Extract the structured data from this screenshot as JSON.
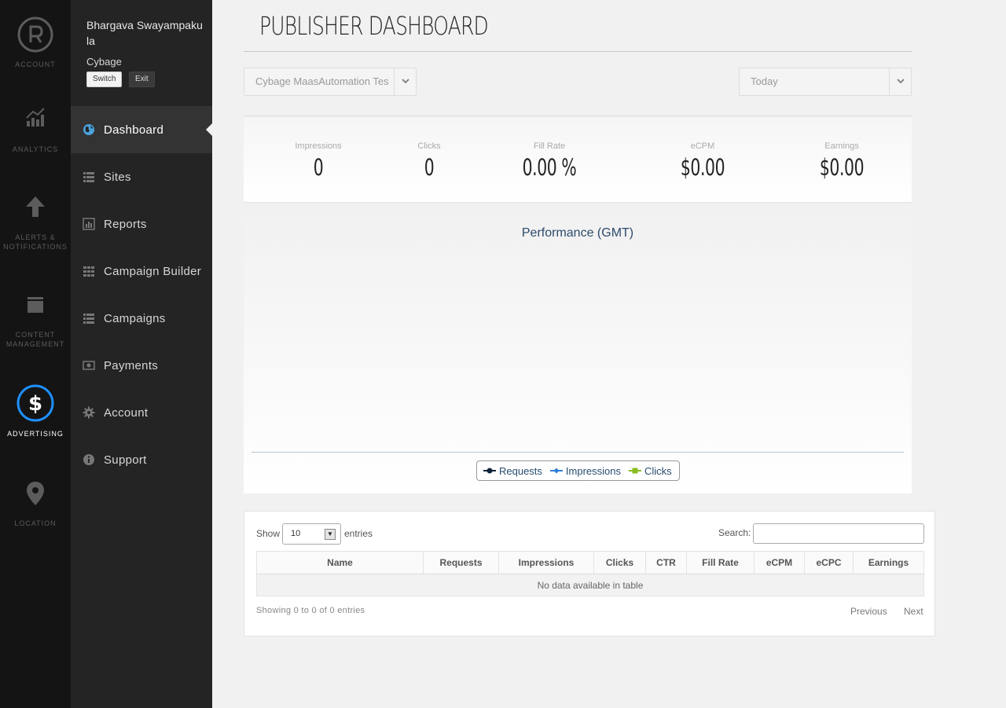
{
  "rail": {
    "items": [
      {
        "label": "ACCOUNT"
      },
      {
        "label": "ANALYTICS"
      },
      {
        "label": "ALERTS &",
        "label2": "NOTIFICATIONS"
      },
      {
        "label": "CONTENT",
        "label2": "MANAGEMENT"
      },
      {
        "label": "ADVERTISING"
      },
      {
        "label": "LOCATION"
      }
    ],
    "active_color": "#1e90ff"
  },
  "user": {
    "name": "Bhargava Swayampakula",
    "org": "Cybage",
    "switch_label": "Switch",
    "exit_label": "Exit"
  },
  "nav": {
    "items": [
      {
        "label": "Dashboard",
        "icon": "globe-icon"
      },
      {
        "label": "Sites",
        "icon": "list-icon"
      },
      {
        "label": "Reports",
        "icon": "bar-chart-icon"
      },
      {
        "label": "Campaign Builder",
        "icon": "grid-icon"
      },
      {
        "label": "Campaigns",
        "icon": "list-icon"
      },
      {
        "label": "Payments",
        "icon": "money-icon"
      },
      {
        "label": "Account",
        "icon": "gear-icon"
      },
      {
        "label": "Support",
        "icon": "info-icon"
      }
    ],
    "active": "Dashboard"
  },
  "header": {
    "title": "PUBLISHER DASHBOARD"
  },
  "filters": {
    "site_selected": "Cybage MaasAutomation Tes",
    "range_selected": "Today"
  },
  "stats": {
    "impressions_label": "Impressions",
    "impressions_value": "0",
    "clicks_label": "Clicks",
    "clicks_value": "0",
    "fill_label": "Fill Rate",
    "fill_value": "0.00 %",
    "ecpm_label": "eCPM",
    "ecpm_value": "$0.00",
    "earnings_label": "Earnings",
    "earnings_value": "$0.00"
  },
  "chart_data": {
    "type": "line",
    "title": "Performance (GMT)",
    "series": [
      {
        "name": "Requests",
        "values": [],
        "color": "#0d233a"
      },
      {
        "name": "Impressions",
        "values": [],
        "color": "#2f7ed8"
      },
      {
        "name": "Clicks",
        "values": [],
        "color": "#8bbc21"
      }
    ]
  },
  "table": {
    "show_label": "Show",
    "length_value": "10",
    "entries_label": "entries",
    "search_label": "Search:",
    "columns": [
      "Name",
      "Requests",
      "Impressions",
      "Clicks",
      "CTR",
      "Fill Rate",
      "eCPM",
      "eCPC",
      "Earnings"
    ],
    "empty_message": "No data available in table",
    "info": "Showing 0 to 0 of 0 entries",
    "prev_label": "Previous",
    "next_label": "Next"
  }
}
